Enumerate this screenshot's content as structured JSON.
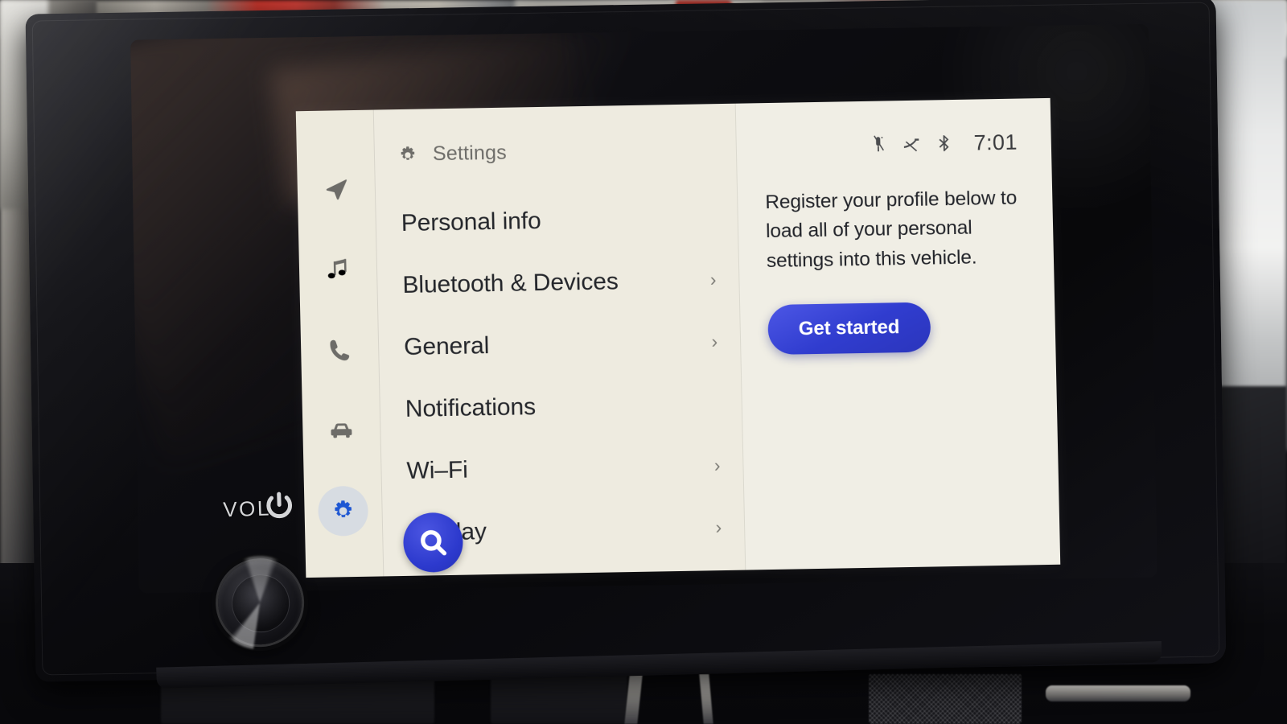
{
  "device": {
    "physical_controls": {
      "volume_label": "VOL",
      "power_icon": "power-icon",
      "knob": "volume-knob"
    }
  },
  "ui": {
    "rail": {
      "items": [
        {
          "icon": "navigation-arrow-icon",
          "name": "navigation",
          "active": false
        },
        {
          "icon": "music-note-icon",
          "name": "media",
          "active": false
        },
        {
          "icon": "phone-icon",
          "name": "phone",
          "active": false
        },
        {
          "icon": "car-icon",
          "name": "vehicle",
          "active": false
        },
        {
          "icon": "gear-icon",
          "name": "settings",
          "active": true
        }
      ]
    },
    "list_pane": {
      "header": {
        "icon": "gear-icon",
        "title": "Settings"
      },
      "menu": [
        {
          "label": "Personal info",
          "chevron": "",
          "has_chevron": false
        },
        {
          "label": "Bluetooth & Devices",
          "chevron": "›",
          "has_chevron": true
        },
        {
          "label": "General",
          "chevron": "›",
          "has_chevron": true
        },
        {
          "label": "Notifications",
          "chevron": "",
          "has_chevron": false
        },
        {
          "label": "Wi–Fi",
          "chevron": "›",
          "has_chevron": true
        },
        {
          "label": "Display",
          "chevron": "›",
          "has_chevron": true
        }
      ],
      "fab": {
        "icon": "search-icon",
        "name": "search"
      }
    },
    "detail_pane": {
      "status_bar": {
        "icons": [
          "microphone-muted-icon",
          "sound-muted-icon",
          "bluetooth-icon"
        ],
        "time": "7:01"
      },
      "body_text": "Register your profile below to load all of your personal settings into this vehicle.",
      "cta_label": "Get started"
    },
    "colors": {
      "rail_bg": "#edeadc",
      "list_bg": "#eeebdf",
      "detail_bg": "#f0eee4",
      "accent_blue": "#2f3cd8",
      "active_chip": "#d7dce2",
      "text_primary": "#24262b",
      "text_secondary": "#6e6d69"
    }
  }
}
